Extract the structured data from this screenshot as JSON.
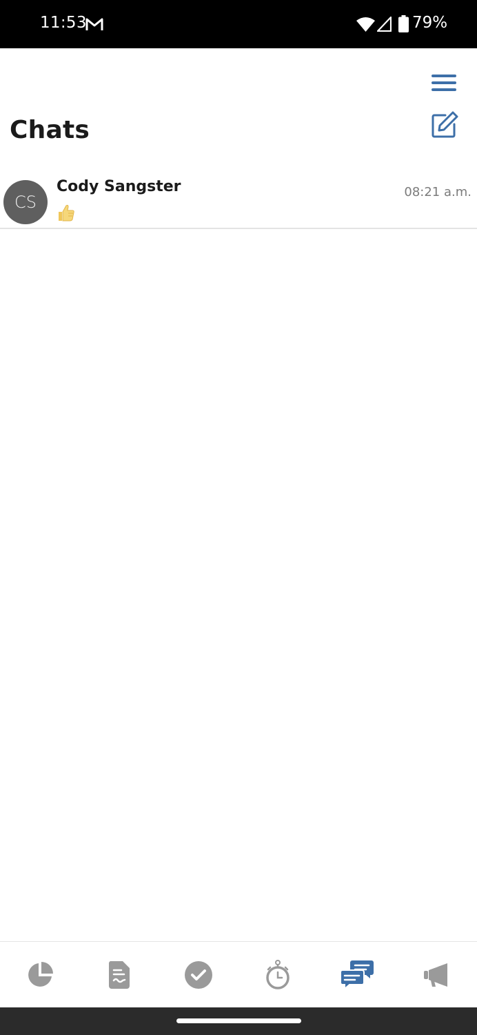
{
  "status_bar": {
    "time": "11:53",
    "battery": "79%",
    "icons": [
      "gmail-icon",
      "wifi-icon",
      "cellular-signal-icon",
      "battery-icon"
    ]
  },
  "header": {
    "title": "Chats",
    "menu_icon": "hamburger-menu-icon",
    "compose_icon": "compose-edit-icon",
    "accent_color": "#3d6fa8"
  },
  "chats": [
    {
      "initials": "CS",
      "name": "Cody Sangster",
      "preview_icon": "thumbs-up-emoji",
      "time": "08:21 a.m."
    }
  ],
  "bottom_nav": {
    "items": [
      {
        "icon": "pie-chart-icon",
        "active": false
      },
      {
        "icon": "document-icon",
        "active": false
      },
      {
        "icon": "check-circle-icon",
        "active": false
      },
      {
        "icon": "stopwatch-icon",
        "active": false
      },
      {
        "icon": "chat-bubbles-icon",
        "active": true
      },
      {
        "icon": "megaphone-icon",
        "active": false
      }
    ],
    "active_color": "#3d6fa8",
    "inactive_color": "#9a9a9a"
  }
}
